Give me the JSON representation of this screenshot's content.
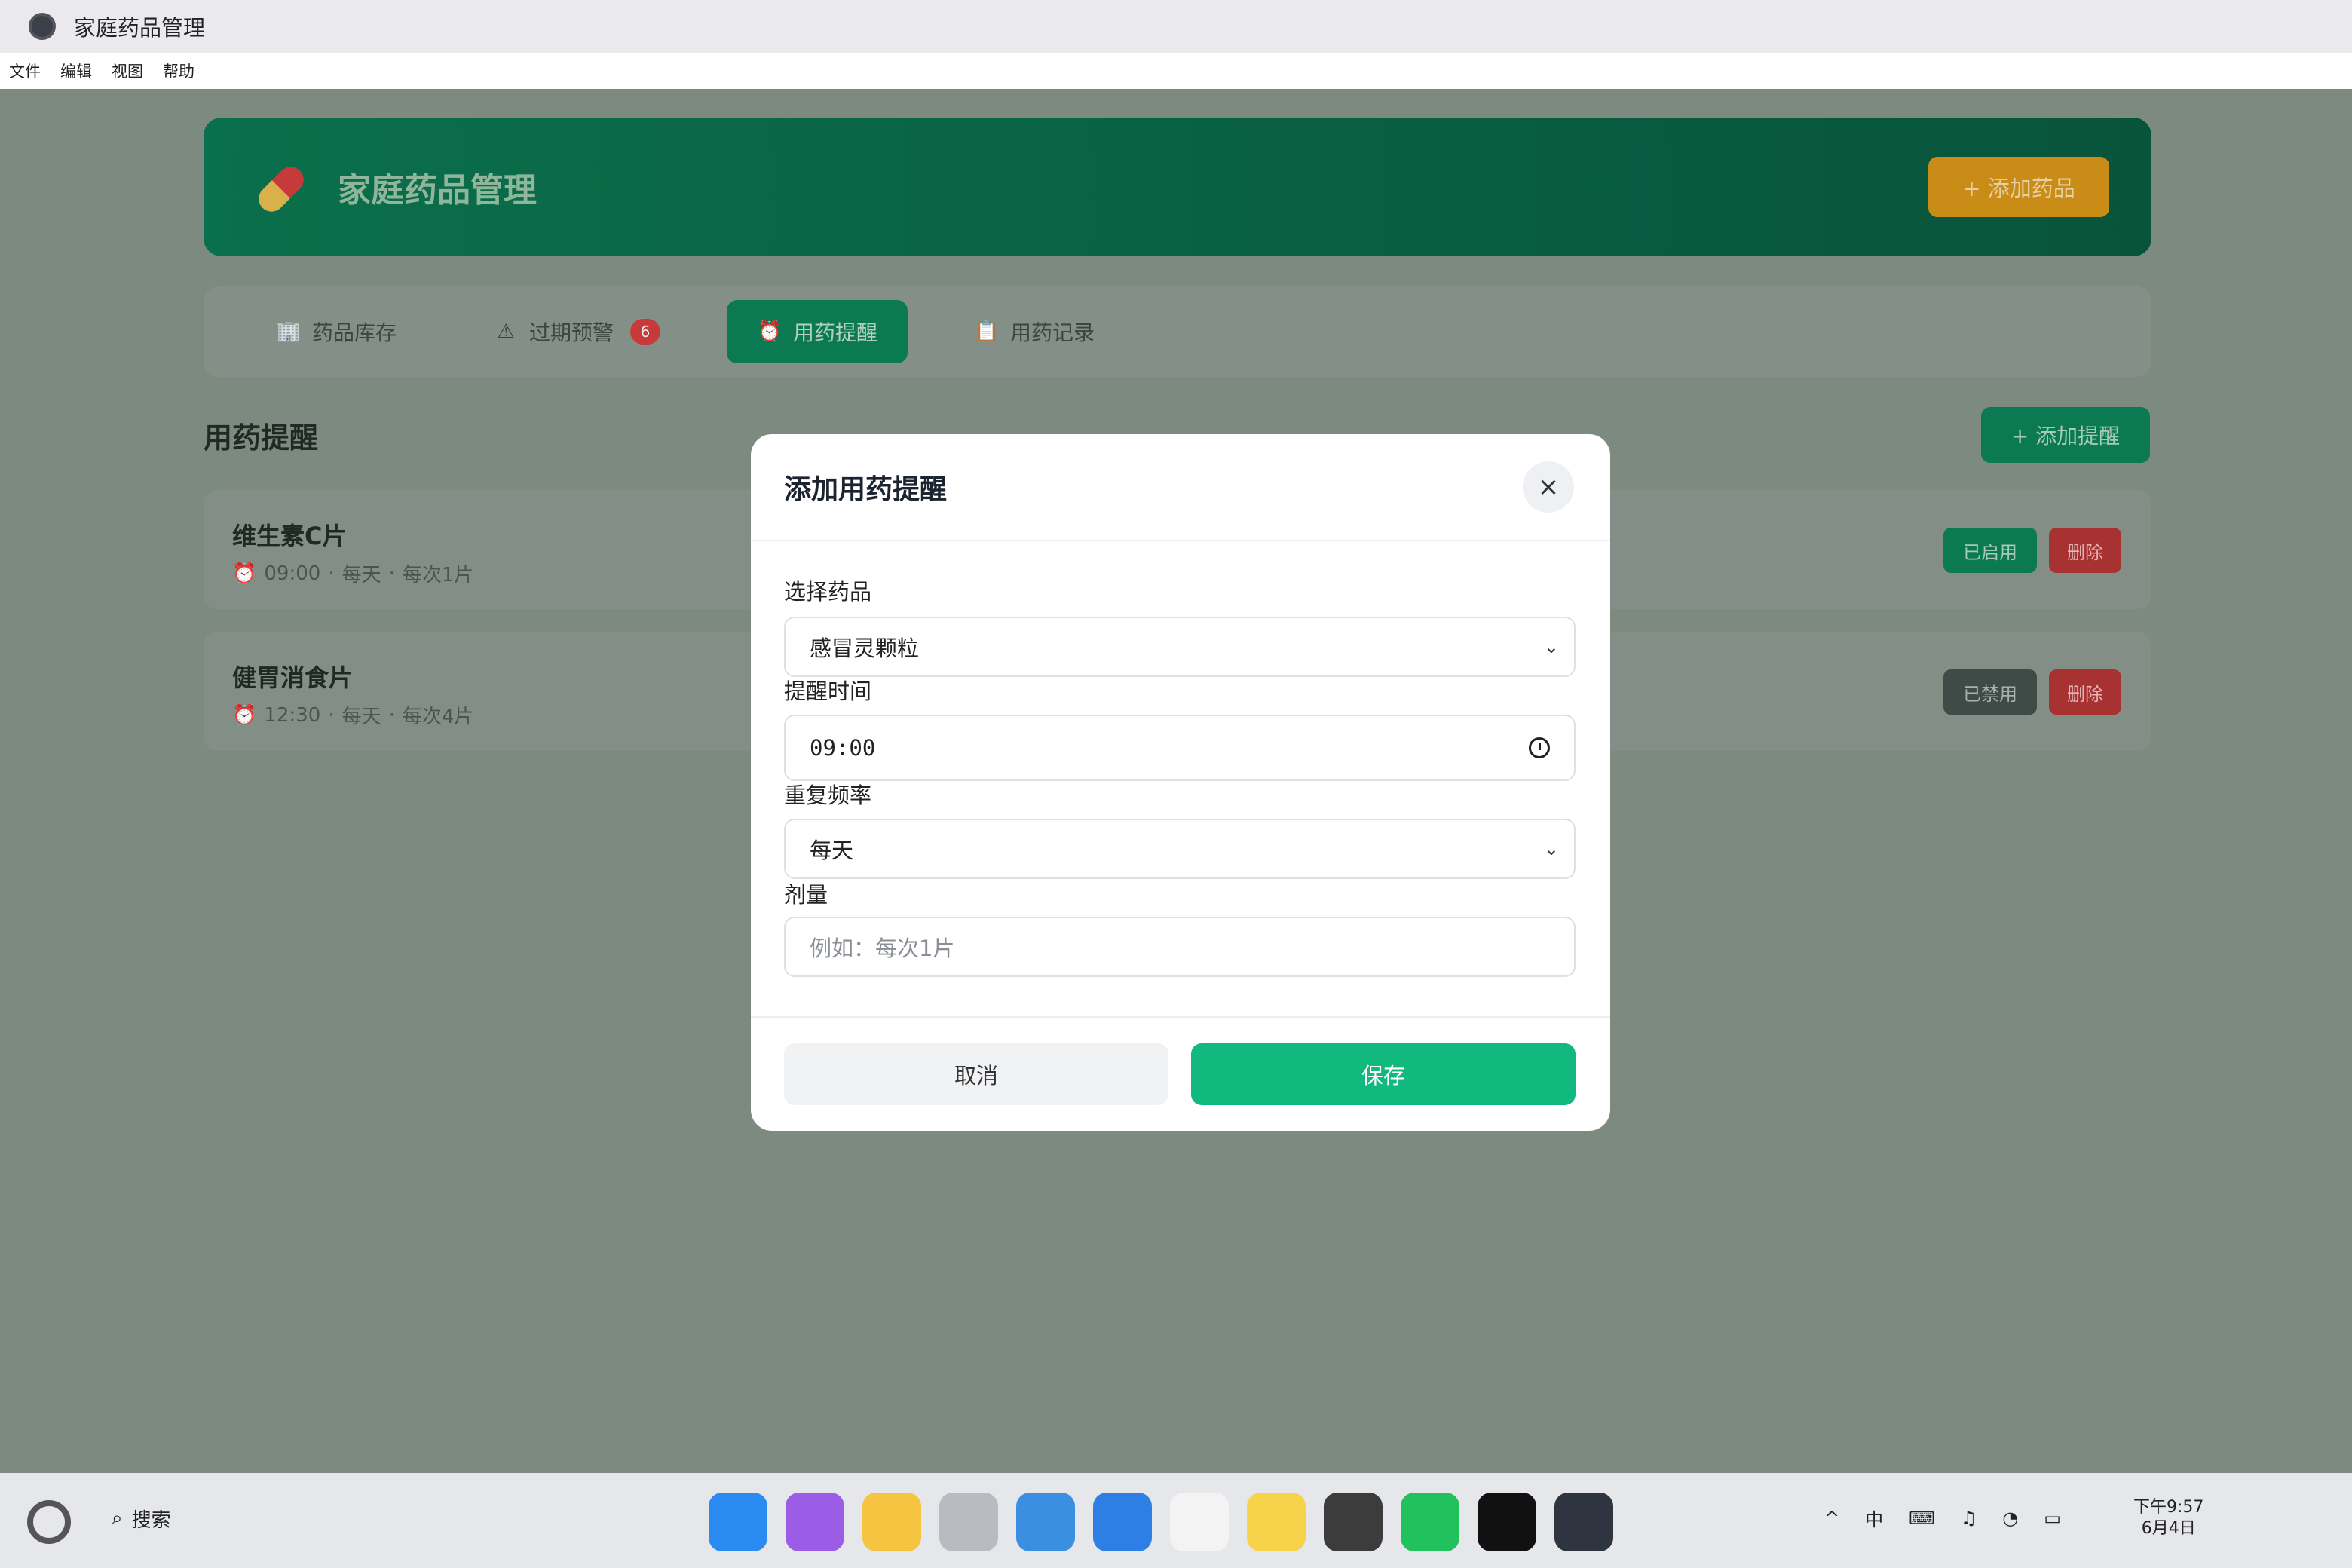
{
  "window": {
    "title": "家庭药品管理"
  },
  "menu": [
    "文件",
    "编辑",
    "视图",
    "帮助"
  ],
  "header": {
    "title": "家庭药品管理",
    "add_button": "+ 添加药品"
  },
  "tabs": [
    {
      "label": "药品库存",
      "icon": "building-icon"
    },
    {
      "label": "过期预警",
      "icon": "warning-icon",
      "badge": "6"
    },
    {
      "label": "用药提醒",
      "icon": "alarm-clock-icon",
      "active": true
    },
    {
      "label": "用药记录",
      "icon": "clipboard-icon"
    }
  ],
  "section": {
    "title": "用药提醒",
    "add_button": "+ 添加提醒"
  },
  "reminders": [
    {
      "name": "维生素C片",
      "time": "09:00",
      "freq": "每天",
      "dose": "每次1片",
      "status": "已启用",
      "delete": "删除"
    },
    {
      "name": "健胃消食片",
      "time": "12:30",
      "freq": "每天",
      "dose": "每次4片",
      "status": "已禁用",
      "delete": "删除"
    }
  ],
  "modal": {
    "title": "添加用药提醒",
    "close": "×",
    "medicine_label": "选择药品",
    "medicine_value": "感冒灵颗粒",
    "time_label": "提醒时间",
    "time_value": "09:00",
    "freq_label": "重复频率",
    "freq_value": "每天",
    "dose_label": "剂量",
    "dose_placeholder": "例如：每次1片",
    "cancel": "取消",
    "save": "保存"
  },
  "taskbar": {
    "search": "搜索",
    "ime": "中",
    "time": "下午9:57",
    "date": "6月4日"
  },
  "colors": {
    "primary": "#12b97e",
    "danger": "#c83a3a",
    "warning": "#c98c17"
  }
}
